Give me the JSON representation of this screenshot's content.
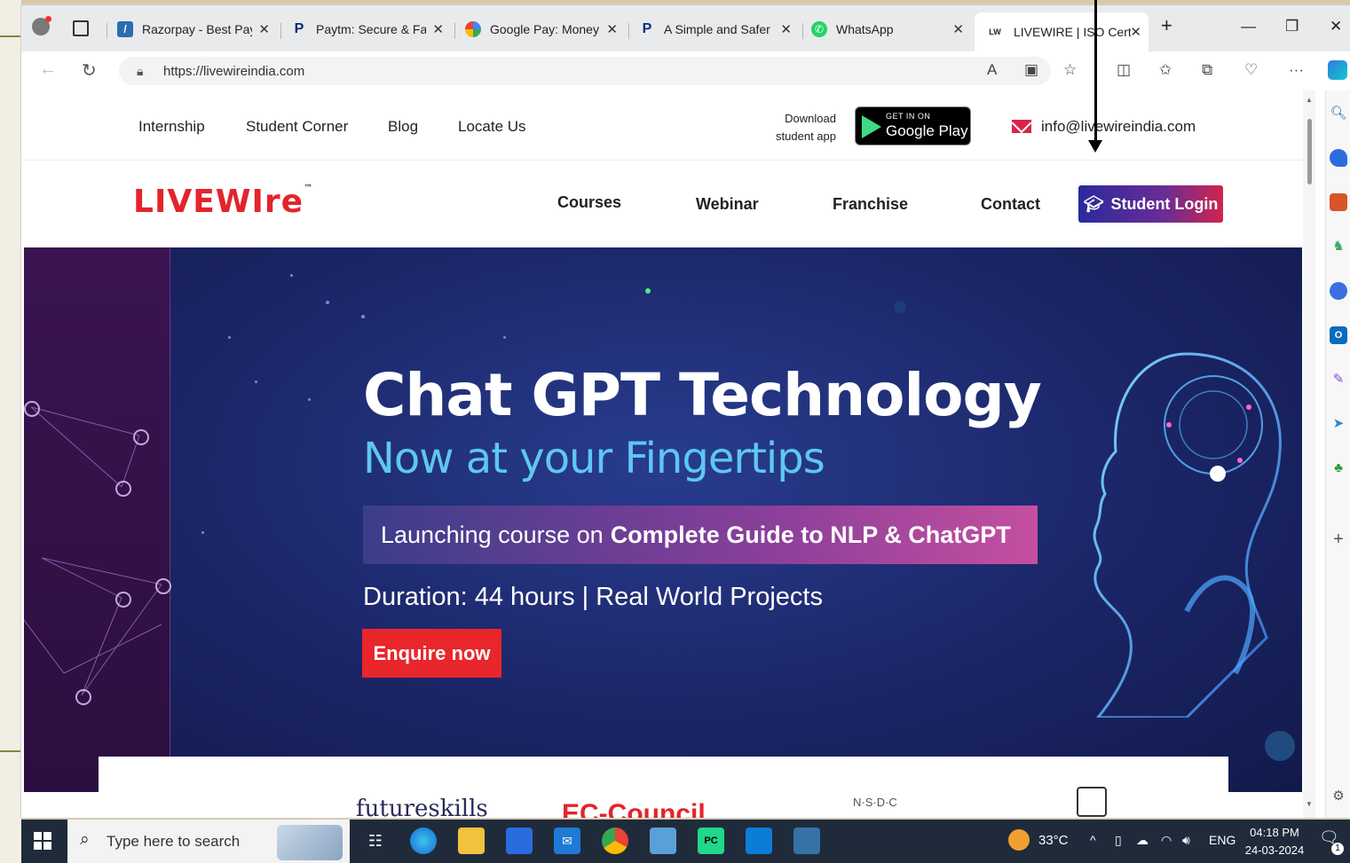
{
  "browser": {
    "tabs": [
      {
        "title": "Razorpay - Best Paym",
        "favicon": "razorpay-icon",
        "color": "#2b6cb0"
      },
      {
        "title": "Paytm: Secure & Fast",
        "favicon": "paytm-icon",
        "color": "#002e6e"
      },
      {
        "title": "Google Pay: Money r",
        "favicon": "google-pay-icon",
        "color": "#f4b400"
      },
      {
        "title": "A Simple and Safer W",
        "favicon": "paypal-icon",
        "color": "#003087"
      },
      {
        "title": "WhatsApp",
        "favicon": "whatsapp-icon",
        "color": "#25d366"
      },
      {
        "title": "LIVEWIRE | ISO Certifi",
        "favicon": "livewire-icon",
        "color": "#e3242b",
        "active": true
      }
    ],
    "new_tab": "+",
    "url": "https://livewireindia.com"
  },
  "site": {
    "top_links": [
      "Internship",
      "Student Corner",
      "Blog",
      "Locate Us"
    ],
    "download_text_line1": "Download",
    "download_text_line2": "student app",
    "gplay_small": "GET IN ON",
    "gplay_big": "Google Play",
    "email": "info@livewireindia.com",
    "logo": "LIVEWIre",
    "logo_tm": "™",
    "nav_links": [
      "Courses",
      "Webinar",
      "Franchise",
      "Contact"
    ],
    "login_label": "Student Login"
  },
  "hero": {
    "headline": "Chat GPT Technology",
    "subheadline": "Now at your Fingertips",
    "ribbon_pre": "Launching course on",
    "ribbon_strong": "Complete Guide to NLP & ChatGPT",
    "duration": "Duration: 44 hours | Real World Projects",
    "cta": "Enquire now"
  },
  "partners": [
    "futureskills",
    "EC-Council",
    "N·S·D·C"
  ],
  "taskbar": {
    "search_placeholder": "Type here to search",
    "weather": "33°C",
    "lang": "ENG",
    "time": "04:18 PM",
    "date": "24-03-2024",
    "notification_count": "1"
  },
  "colors": {
    "brand_red": "#e3242b",
    "hero_bg": "#1b2566",
    "accent_cyan": "#5ec7f0"
  }
}
